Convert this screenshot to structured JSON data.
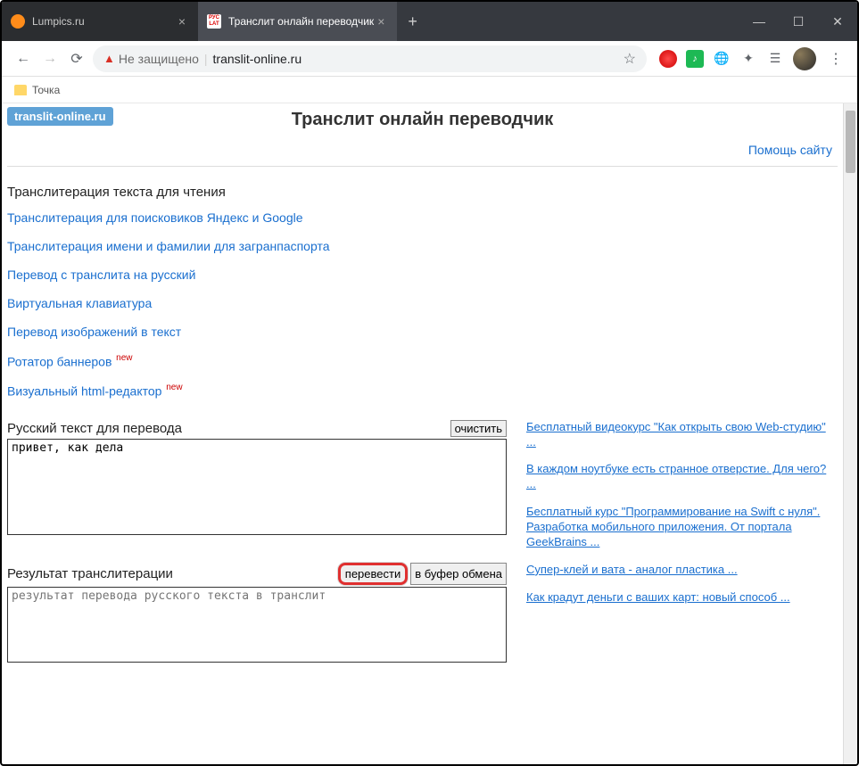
{
  "browser": {
    "tabs": [
      {
        "title": "Lumpics.ru",
        "active": false
      },
      {
        "title": "Транслит онлайн переводчик",
        "active": true
      }
    ],
    "warn_text": "Не защищено",
    "url": "translit-online.ru",
    "bookmark": "Точка"
  },
  "page": {
    "logo": "translit-online.ru",
    "title": "Транслит онлайн переводчик",
    "help_link": "Помощь сайту",
    "heading": "Транслитерация текста для чтения",
    "links": [
      {
        "text": "Транслитерация для поисковиков Яндекс и Google",
        "new": false
      },
      {
        "text": "Транслитерация имени и фамилии для загранпаспорта",
        "new": false
      },
      {
        "text": "Перевод с транслита на русский",
        "new": false
      },
      {
        "text": "Виртуальная клавиатура",
        "new": false
      },
      {
        "text": "Перевод изображений в текст",
        "new": false
      },
      {
        "text": "Ротатор баннеров",
        "new": true
      },
      {
        "text": "Визуальный html-редактор",
        "new": true
      }
    ],
    "new_label": "new",
    "input_label": "Русский текст для перевода",
    "input_clear": "очистить",
    "input_value": "привет, как дела",
    "output_label": "Результат транслитерации",
    "btn_translate": "перевести",
    "btn_clipboard": "в буфер обмена",
    "output_placeholder": "результат перевода русского текста в транслит",
    "sidebar": [
      "Бесплатный видеокурс \"Как открыть свою Web-студию\" ...",
      "В каждом ноутбуке есть странное отверстие. Для чего? ...",
      "Бесплатный курс \"Программирование на Swift с нуля\". Разработка мобильного приложения. От портала GeekBrains ...",
      "Супер-клей и вата - аналог пластика ...",
      "Как крадут деньги с ваших карт: новый способ ..."
    ]
  }
}
